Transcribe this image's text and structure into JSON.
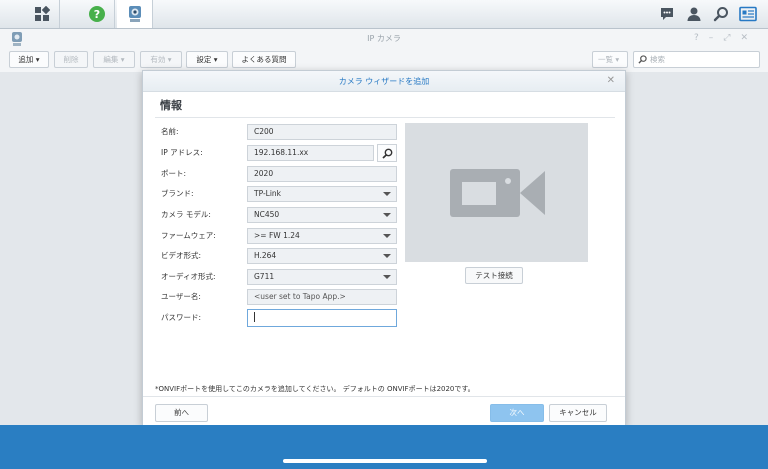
{
  "taskbar": {
    "right_icons": [
      "chat-icon",
      "user-icon",
      "search-icon",
      "widgets-icon"
    ]
  },
  "window": {
    "title": "IP カメラ",
    "toolbar": {
      "add": "追加",
      "delete": "削除",
      "edit": "編集",
      "enable": "有効",
      "settings": "設定",
      "faq": "よくある質問",
      "view": "一覧",
      "search_placeholder": "検索"
    }
  },
  "dialog": {
    "title": "カメラ ウィザードを追加",
    "section": "情報",
    "fields": {
      "name_label": "名前:",
      "name_value": "C200",
      "ip_label": "IP アドレス:",
      "ip_value": "192.168.11.xx",
      "port_label": "ポート:",
      "port_value": "2020",
      "brand_label": "ブランド:",
      "brand_value": "TP-Link",
      "model_label": "カメラ モデル:",
      "model_value": "NC450",
      "firmware_label": "ファームウェア:",
      "firmware_value": ">= FW 1.24",
      "video_label": "ビデオ形式:",
      "video_value": "H.264",
      "audio_label": "オーディオ形式:",
      "audio_value": "G711",
      "user_label": "ユーザー名:",
      "user_value": "<user set to Tapo App.>",
      "password_label": "パスワード:",
      "password_value": ""
    },
    "test_button": "テスト接続",
    "footnote": "*ONVIFポートを使用してこのカメラを追加してください。 デフォルトの ONVIFポートは2020です。",
    "buttons": {
      "back": "前へ",
      "next": "次へ",
      "cancel": "キャンセル"
    }
  },
  "colors": {
    "accent": "#2779c4",
    "primary_button": "#8ec4ef",
    "bottom_bar": "#2a7ec2"
  }
}
